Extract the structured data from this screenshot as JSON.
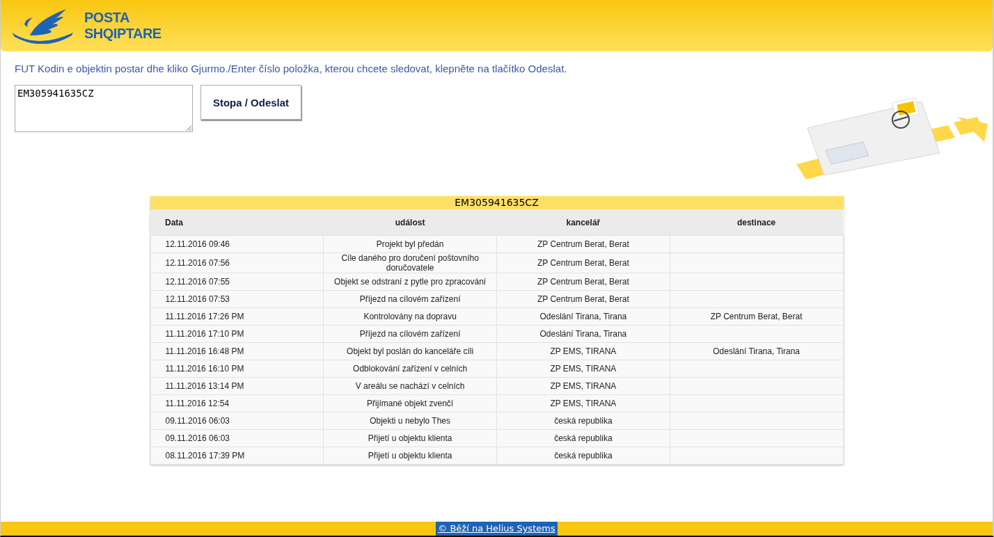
{
  "header": {
    "logo_line_1": "POSTA",
    "logo_line_2": "SHQIPTARE"
  },
  "instruction": "FUT Kodin e objektin postar dhe kliko Gjurmo./Enter číslo položka, kterou chcete sledovat, klepněte na tlačítko Odeslat.",
  "tracking_field": {
    "value": "EM305941635CZ"
  },
  "submit_button": "Stopa / Odeslat",
  "table": {
    "caption": "EM305941635CZ",
    "columns": [
      "Data",
      "událost",
      "kancelář",
      "destinace"
    ],
    "rows": [
      [
        "12.11.2016 09:46",
        "Projekt byl předán",
        "ZP Centrum Berat, Berat",
        ""
      ],
      [
        "12.11.2016 07:56",
        "Cíle daného pro doručení poštovního doručovatele",
        "ZP Centrum Berat, Berat",
        ""
      ],
      [
        "12.11.2016 07:55",
        "Objekt se odstraní z pytle pro zpracování",
        "ZP Centrum Berat, Berat",
        ""
      ],
      [
        "12.11.2016 07:53",
        "Příjezd na cílovém zařízení",
        "ZP Centrum Berat, Berat",
        ""
      ],
      [
        "11.11.2016 17:26 PM",
        "Kontrolovány na dopravu",
        "Odeslání Tirana, Tirana",
        "ZP Centrum Berat, Berat"
      ],
      [
        "11.11.2016 17:10 PM",
        "Příjezd na cílovém zařízení",
        "Odeslání Tirana, Tirana",
        ""
      ],
      [
        "11.11.2016 16:48 PM",
        "Objekt byl poslán do kanceláře cíli",
        "ZP EMS, TIRANA",
        "Odeslání Tirana, Tirana"
      ],
      [
        "11.11.2016 16:10 PM",
        "Odblokování zařízení v celních",
        "ZP EMS, TIRANA",
        ""
      ],
      [
        "11.11.2016 13:14 PM",
        "V areálu se nachází v celních",
        "ZP EMS, TIRANA",
        ""
      ],
      [
        "11.11.2016 12:54",
        "Přijímané objekt zvenčí",
        "ZP EMS, TIRANA",
        ""
      ],
      [
        "09.11.2016 06:03",
        "Objekti u nebylo Thes",
        "česká republika",
        ""
      ],
      [
        "09.11.2016 06:03",
        "Přijetí u objektu klienta",
        "česká republika",
        ""
      ],
      [
        "08.11.2016 17:39 PM",
        "Přijetí u objektu klienta",
        "česká republika",
        ""
      ]
    ]
  },
  "footer": {
    "link": "© Běží na Helius Systems"
  }
}
